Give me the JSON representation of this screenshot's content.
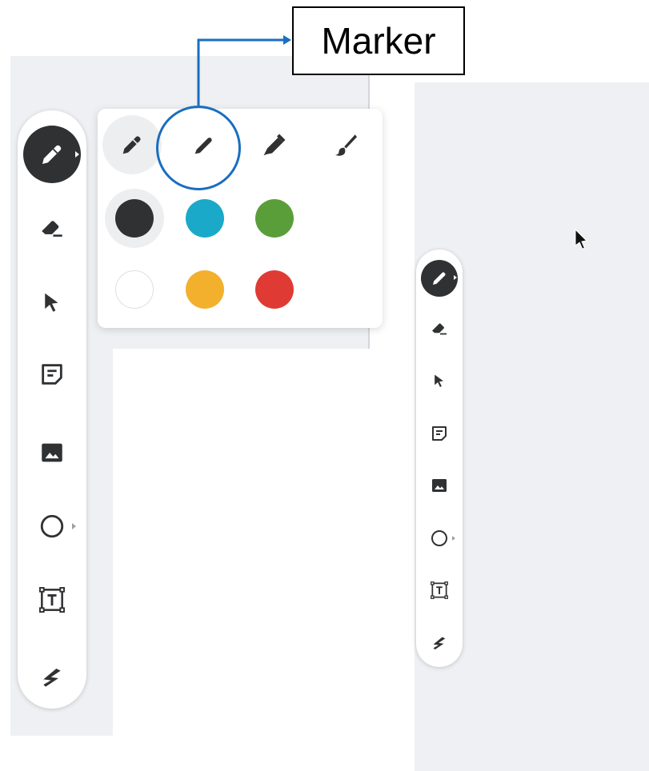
{
  "callout": {
    "label": "Marker"
  },
  "colors": {
    "background": "#eef0f3",
    "toolbar": "#ffffff",
    "active_tool": "#2f3133",
    "icon": "#2f3133",
    "callout_stroke": "#1a6ec0"
  },
  "toolbar_large": {
    "tools": [
      {
        "name": "pen-tool",
        "icon": "pen-icon",
        "active": true,
        "has_submenu": true
      },
      {
        "name": "eraser-tool",
        "icon": "eraser-icon"
      },
      {
        "name": "select-tool",
        "icon": "cursor-icon"
      },
      {
        "name": "sticky-note-tool",
        "icon": "sticky-note-icon"
      },
      {
        "name": "image-tool",
        "icon": "image-icon"
      },
      {
        "name": "shape-tool",
        "icon": "circle-icon",
        "has_submenu": true
      },
      {
        "name": "text-tool",
        "icon": "text-box-icon"
      },
      {
        "name": "laser-tool",
        "icon": "laser-icon"
      }
    ]
  },
  "pen_popup": {
    "pen_types": [
      {
        "name": "pen",
        "icon": "pen-icon",
        "selected": true
      },
      {
        "name": "marker",
        "icon": "marker-icon",
        "selected": false
      },
      {
        "name": "highlighter",
        "icon": "highlighter-icon",
        "selected": false
      },
      {
        "name": "brush",
        "icon": "brush-icon",
        "selected": false
      }
    ],
    "swatches": [
      {
        "name": "black",
        "color": "#2f3133",
        "selected": true
      },
      {
        "name": "teal",
        "color": "#1aa9c9",
        "selected": false
      },
      {
        "name": "green",
        "color": "#5a9e3a",
        "selected": false
      },
      {
        "name": "white",
        "color": "#ffffff",
        "selected": false
      },
      {
        "name": "yellow",
        "color": "#f2b02d",
        "selected": false
      },
      {
        "name": "red",
        "color": "#df3b34",
        "selected": false
      }
    ]
  }
}
